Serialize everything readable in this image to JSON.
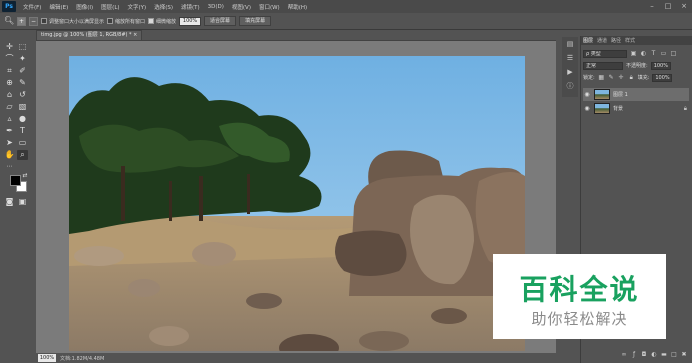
{
  "app": {
    "logo": "Ps"
  },
  "menubar": {
    "items": [
      "文件(F)",
      "编辑(E)",
      "图像(I)",
      "图层(L)",
      "文字(Y)",
      "选择(S)",
      "滤镜(T)",
      "3D(D)",
      "视图(V)",
      "窗口(W)",
      "帮助(H)"
    ],
    "window_controls": {
      "minimize": "–",
      "maximize": "□",
      "close": "×"
    }
  },
  "options_bar": {
    "tool_icon": "zoom-icon",
    "zoom_in_glyph": "+",
    "zoom_out_glyph": "−",
    "resize_windows_label": "调整窗口大小以满屏显示",
    "resize_windows_checked": false,
    "zoom_all_windows_label": "缩放所有窗口",
    "zoom_all_windows_checked": false,
    "scrubby_zoom_label": "细微缩放",
    "scrubby_zoom_checked": true,
    "zoom_value": "100%",
    "fit_screen_label": "适合屏幕",
    "fill_screen_label": "填充屏幕"
  },
  "document": {
    "tab_title": "timg.jpg @ 100% (图层 1, RGB/8#) *",
    "tab_close": "×"
  },
  "statusbar": {
    "zoom": "100%",
    "doc_info": "文档:1.82M/4.48M"
  },
  "layers_panel": {
    "tabs": [
      "图层",
      "通道",
      "路径",
      "样式"
    ],
    "active_tab": "图层",
    "filter_label": "ρ 类型",
    "blend_mode": "正常",
    "opacity_label": "不透明度:",
    "opacity_value": "100%",
    "lock_label": "锁定:",
    "fill_label": "填充:",
    "fill_value": "100%",
    "layers": [
      {
        "name": "图层 1",
        "visible": true,
        "selected": true,
        "locked": false
      },
      {
        "name": "背景",
        "visible": true,
        "selected": false,
        "locked": true
      }
    ],
    "footer_icons": [
      "link-icon",
      "fx-icon",
      "mask-icon",
      "adjustment-icon",
      "folder-icon",
      "new-layer-icon",
      "trash-icon"
    ]
  },
  "watermark": {
    "title": "百科全说",
    "subtitle": "助你轻松解决"
  },
  "colors": {
    "foreground": "#000000",
    "background": "#ffffff",
    "ui_dark": "#535353",
    "watermark_green": "#19a15f"
  }
}
